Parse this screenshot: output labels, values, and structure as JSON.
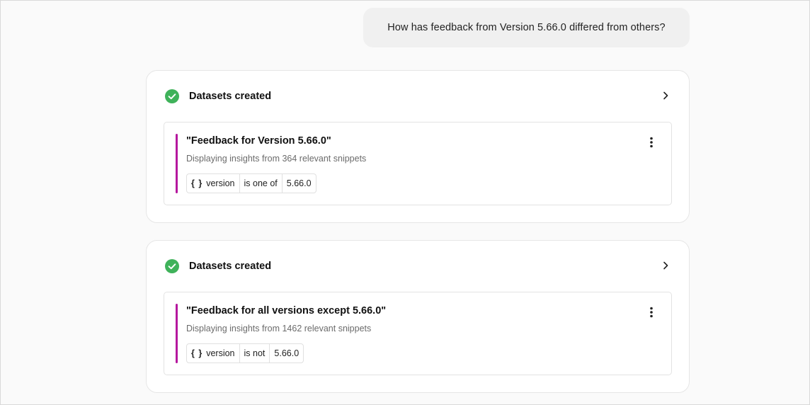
{
  "user_message": "How has feedback from Version 5.66.0 differed from others?",
  "colors": {
    "check_green": "#3fb25a",
    "accent_magenta": "#b5179e"
  },
  "cards": [
    {
      "status_icon": "check-circle-icon",
      "title": "Datasets created",
      "dataset": {
        "title": "\"Feedback for Version 5.66.0\"",
        "subtitle": "Displaying insights from 364 relevant snippets",
        "filter": {
          "icon": "{ }",
          "field": "version",
          "operator": "is one of",
          "value": "5.66.0"
        }
      }
    },
    {
      "status_icon": "check-circle-icon",
      "title": "Datasets created",
      "dataset": {
        "title": "\"Feedback for all versions except 5.66.0\"",
        "subtitle": "Displaying insights from 1462 relevant snippets",
        "filter": {
          "icon": "{ }",
          "field": "version",
          "operator": "is not",
          "value": "5.66.0"
        }
      }
    }
  ]
}
